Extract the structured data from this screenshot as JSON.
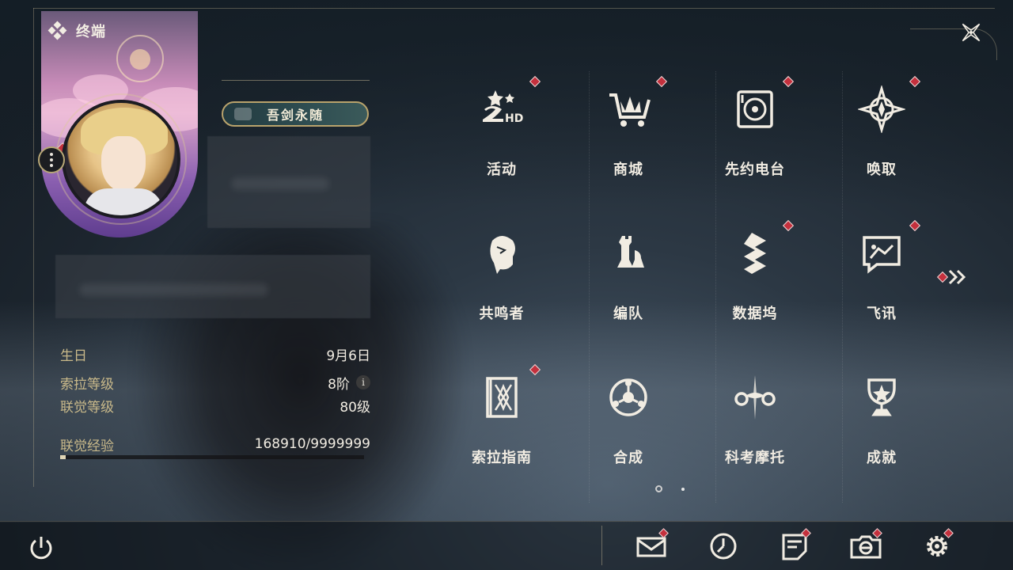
{
  "header": {
    "title": "终端"
  },
  "profile": {
    "title_badge": "吾剑永随",
    "stats": [
      {
        "key": "生日",
        "value": "9月6日"
      },
      {
        "key": "索拉等级",
        "value": "8阶",
        "has_info": true
      },
      {
        "key": "联觉等级",
        "value": "80级"
      },
      {
        "key": "联觉经验",
        "value": "168910/9999999"
      }
    ],
    "exp_progress": 0.017
  },
  "grid": {
    "items": [
      {
        "label": "活动",
        "icon": "event-2hd-icon",
        "badge": true
      },
      {
        "label": "商城",
        "icon": "shop-cart-icon",
        "badge": true
      },
      {
        "label": "先约电台",
        "icon": "radio-record-icon",
        "badge": true
      },
      {
        "label": "唤取",
        "icon": "summon-compass-icon",
        "badge": true
      },
      {
        "label": "共鸣者",
        "icon": "resonator-head-icon",
        "badge": false
      },
      {
        "label": "编队",
        "icon": "team-chess-icon",
        "badge": false
      },
      {
        "label": "数据坞",
        "icon": "data-dock-icon",
        "badge": true
      },
      {
        "label": "飞讯",
        "icon": "chat-message-icon",
        "badge": true
      },
      {
        "label": "索拉指南",
        "icon": "guide-book-icon",
        "badge": true
      },
      {
        "label": "合成",
        "icon": "synthesis-icon",
        "badge": false
      },
      {
        "label": "科考摩托",
        "icon": "motorbike-icon",
        "badge": false
      },
      {
        "label": "成就",
        "icon": "trophy-icon",
        "badge": false
      }
    ],
    "page": 1,
    "page_count": 2
  },
  "bottom": [
    {
      "name": "mail",
      "icon": "mail-icon",
      "badge": true
    },
    {
      "name": "clock",
      "icon": "clock-icon",
      "badge": false
    },
    {
      "name": "notes",
      "icon": "notes-icon",
      "badge": true
    },
    {
      "name": "camera",
      "icon": "camera-icon",
      "badge": true
    },
    {
      "name": "settings",
      "icon": "gear-icon",
      "badge": true
    }
  ],
  "colors": {
    "accent_gold": "#c9b98a",
    "badge_red": "#c4303d",
    "text": "#f1ece2"
  }
}
